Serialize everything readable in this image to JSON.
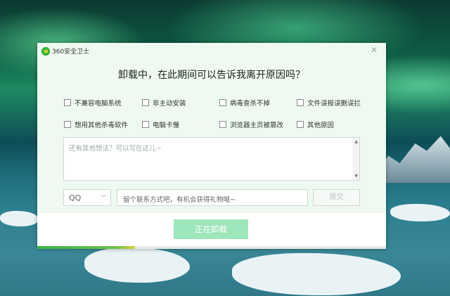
{
  "app": {
    "title": "360安全卫士",
    "close_icon": "close-icon"
  },
  "dialog": {
    "headline": "卸载中，在此期间可以告诉我离开原因吗？"
  },
  "reasons": [
    "不兼容电脑系统",
    "非主动安装",
    "病毒查杀不掉",
    "文件误报误删误拦",
    "想用其他杀毒软件",
    "电脑卡慢",
    "浏览器主页被篡改",
    "其他原因"
  ],
  "feedback": {
    "placeholder": "还有其他想法？可以写在这儿~"
  },
  "contact": {
    "type": "QQ",
    "placeholder": "留个联系方式吧，有机会获得礼物哦~"
  },
  "submit_label": "提交",
  "action_label": "正在卸载",
  "progress": 0.28,
  "colors": {
    "accent": "#9ee6bb",
    "progress": "#3bb54a",
    "dialog_bg": "#eefaf1"
  }
}
